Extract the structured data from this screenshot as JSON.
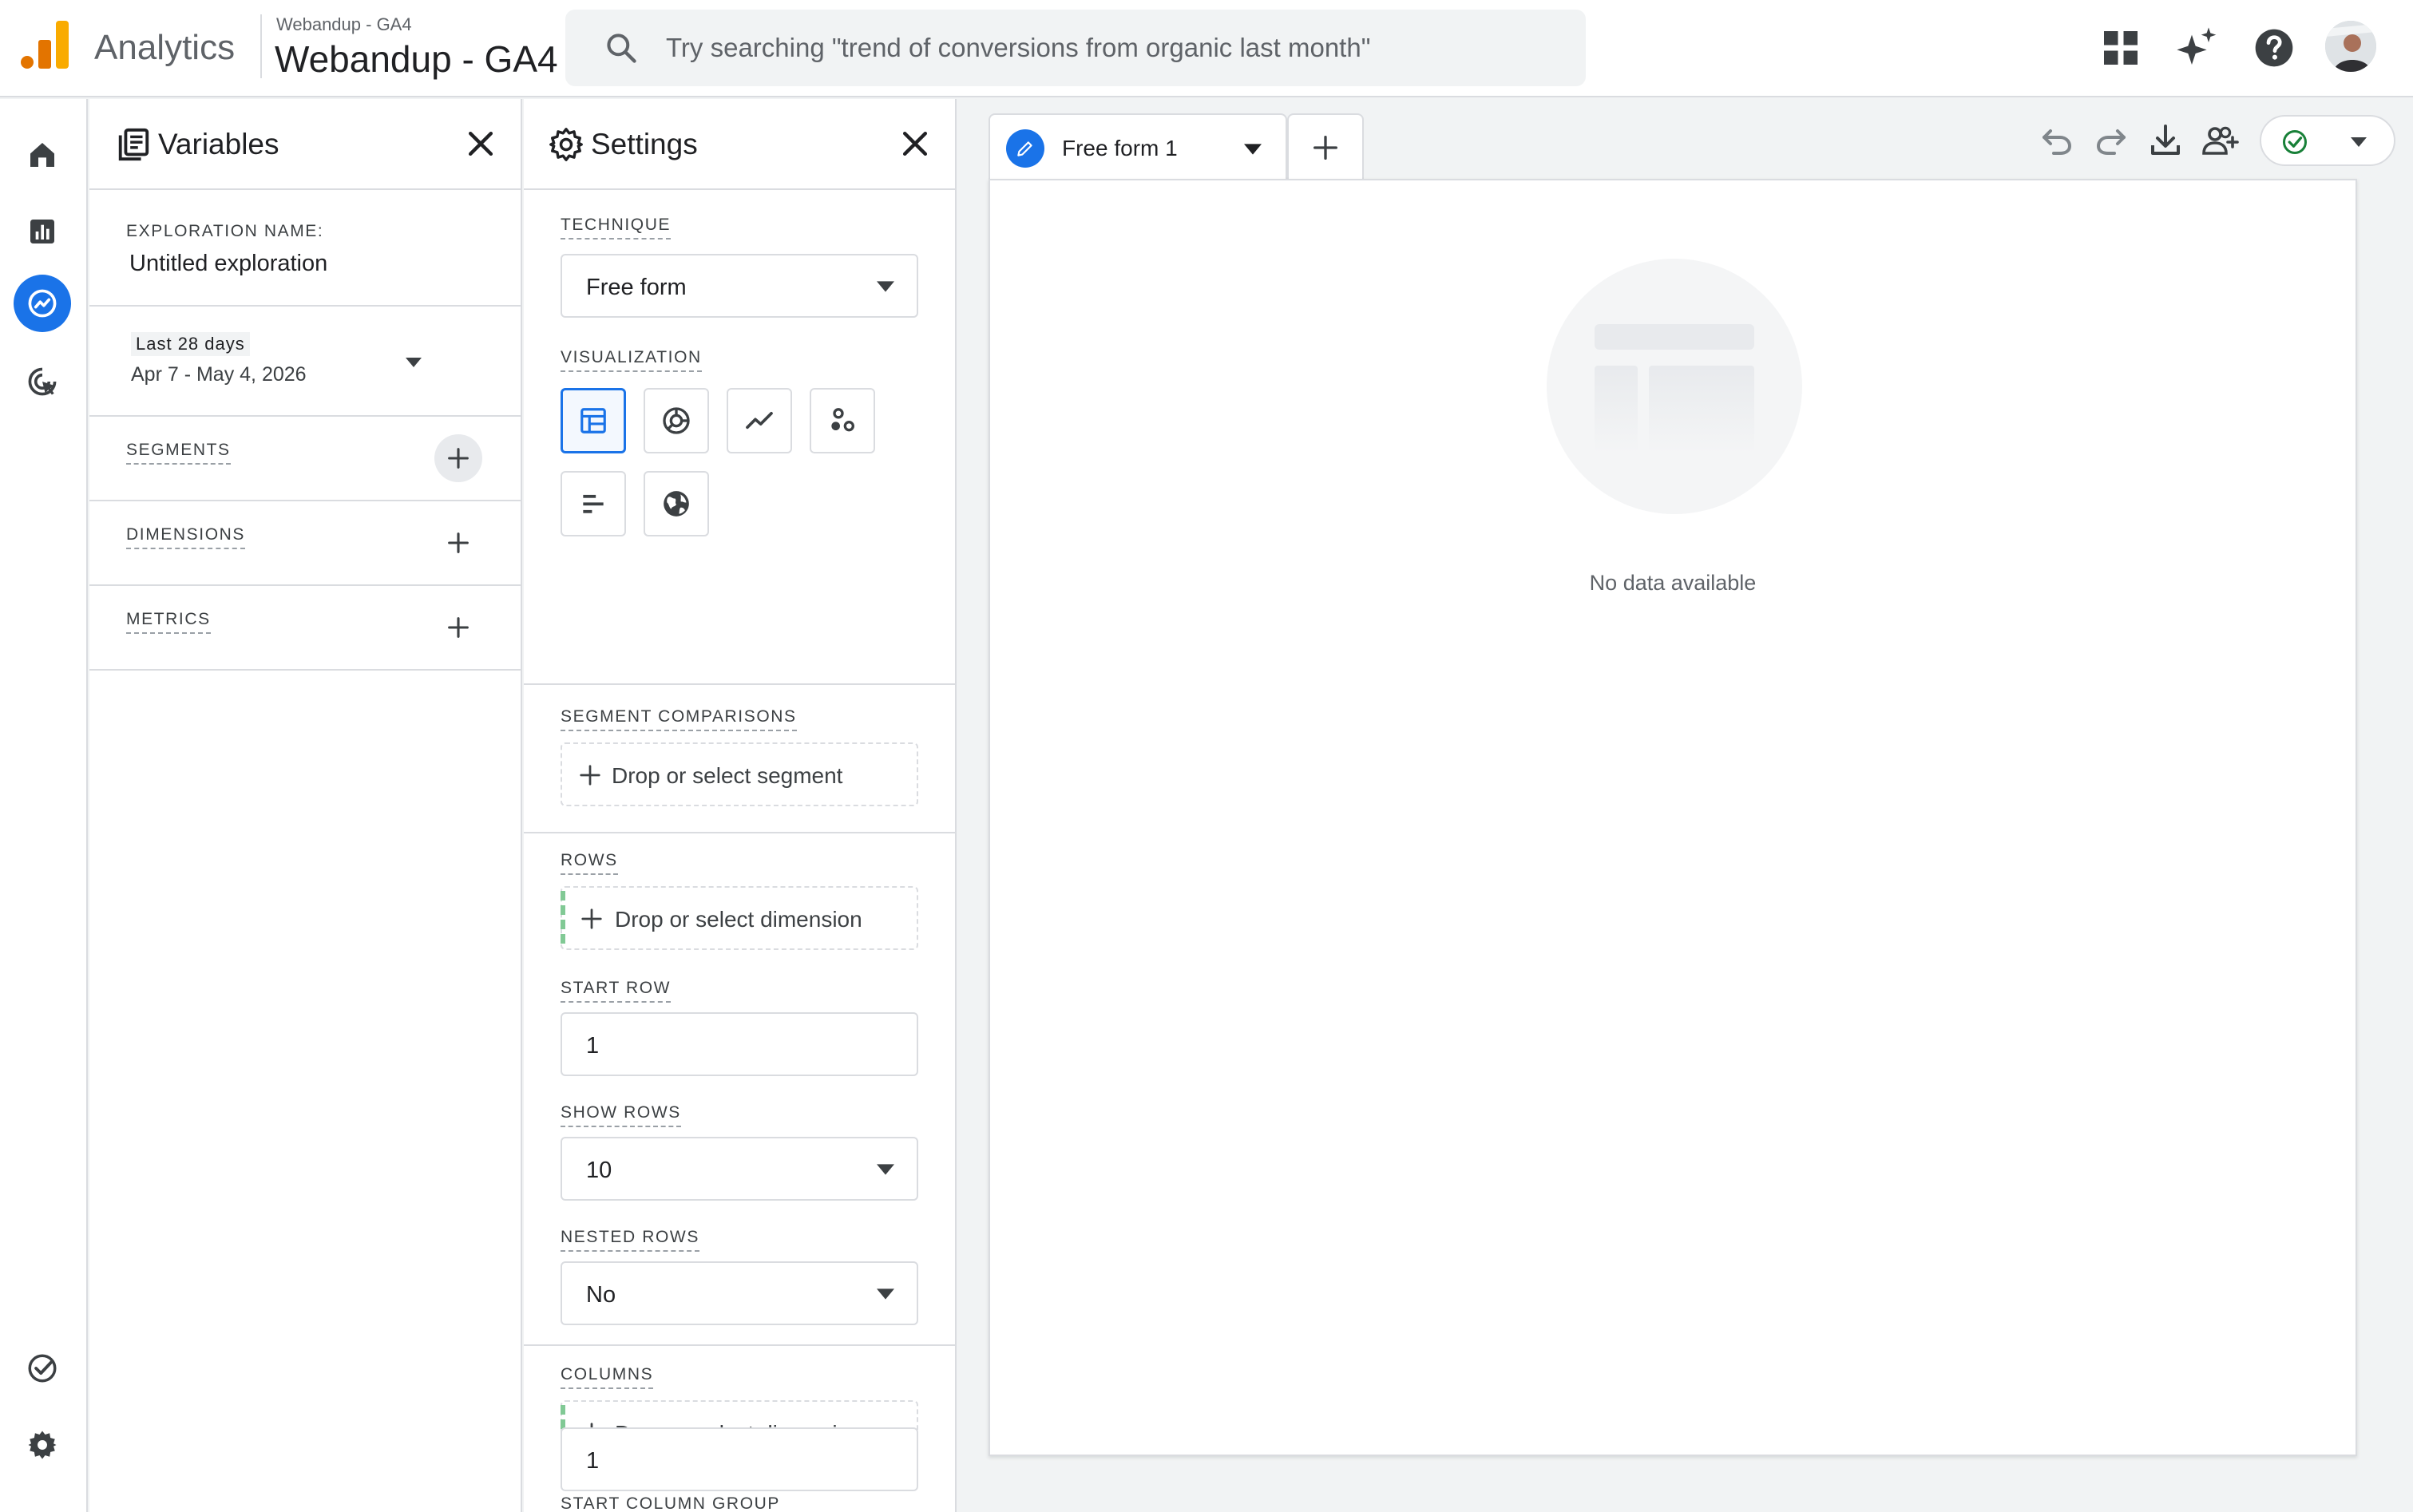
{
  "header": {
    "app_name": "Analytics",
    "account_small": "Webandup - GA4",
    "account_name": "Webandup - GA4",
    "search_placeholder": "Try searching \"trend of conversions from organic last month\"",
    "icons": [
      "apps-grid-icon",
      "sparkle-icon",
      "help-icon"
    ],
    "accent_color": "#1a73e8",
    "logo_colors": [
      "#e37400",
      "#f9ab00"
    ]
  },
  "rail": {
    "items": [
      "home-icon",
      "reports-icon",
      "explore-icon",
      "advertising-icon"
    ],
    "bottom": [
      "admin-check-icon",
      "settings-gear-icon"
    ]
  },
  "variables": {
    "title": "Variables",
    "exploration_label": "EXPLORATION NAME:",
    "exploration_name": "Untitled exploration",
    "date_chip": "Last 28 days",
    "date_range": "Apr 7 - May 4, 2026",
    "segments_label": "SEGMENTS",
    "dimensions_label": "DIMENSIONS",
    "metrics_label": "METRICS"
  },
  "settings": {
    "title": "Settings",
    "technique_label": "TECHNIQUE",
    "technique_value": "Free form",
    "visualization_label": "VISUALIZATION",
    "viz_options": [
      "table-icon",
      "donut-chart-icon",
      "line-chart-icon",
      "scatter-plot-icon",
      "bar-chart-icon",
      "geo-map-icon"
    ],
    "segment_comparisons_label": "SEGMENT COMPARISONS",
    "segment_drop": "Drop or select segment",
    "rows_label": "ROWS",
    "rows_drop": "Drop or select dimension",
    "start_row_label": "START ROW",
    "start_row_value": "1",
    "show_rows_label": "SHOW ROWS",
    "show_rows_value": "10",
    "nested_rows_label": "NESTED ROWS",
    "nested_rows_value": "No",
    "columns_label": "COLUMNS",
    "columns_drop": "Drop or select dimension",
    "start_column_group_label": "START COLUMN GROUP",
    "start_column_group_value": "1"
  },
  "canvas": {
    "tab_label": "Free form 1",
    "empty_message": "No data available",
    "toolbar": [
      "undo-icon",
      "redo-icon",
      "download-icon",
      "share-users-icon",
      "status-check-icon"
    ]
  }
}
